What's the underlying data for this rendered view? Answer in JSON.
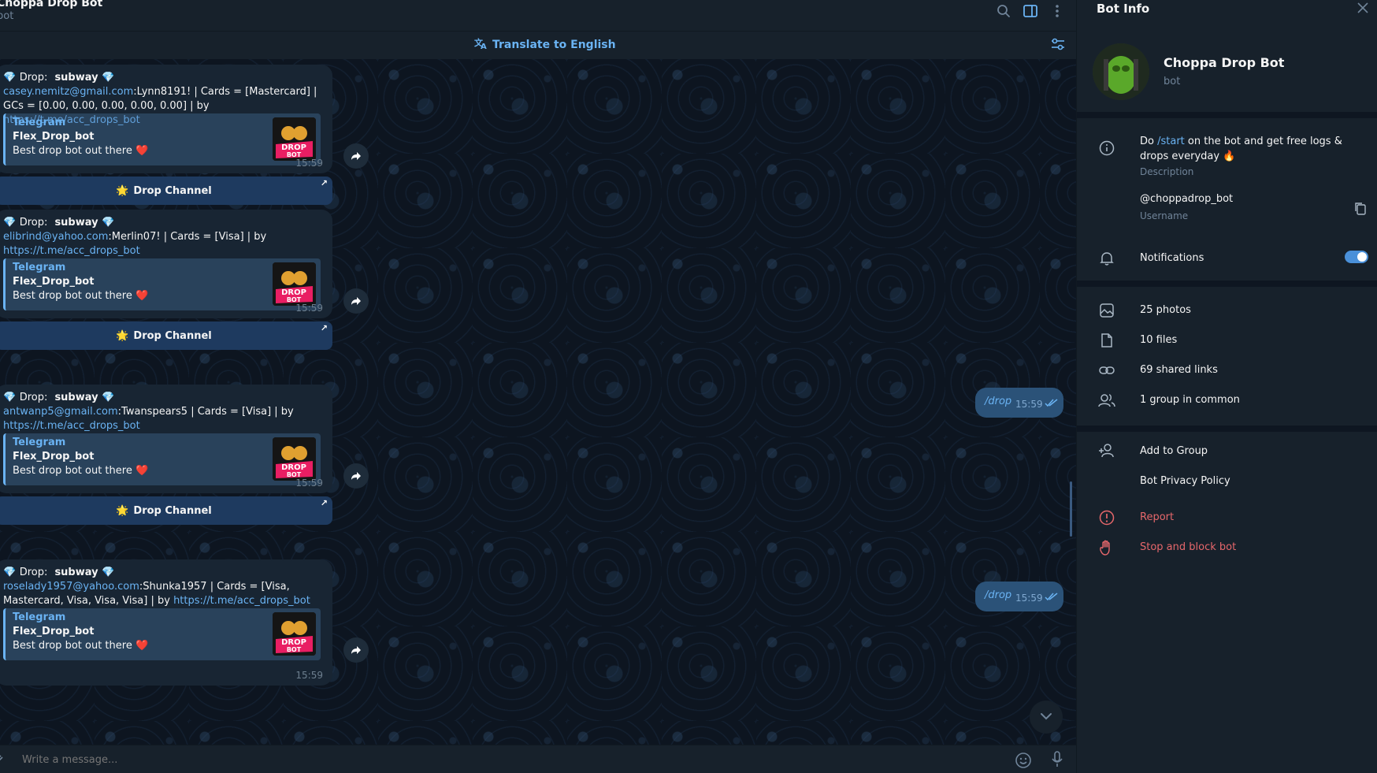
{
  "header": {
    "title": "Choppa Drop Bot",
    "status": "bot"
  },
  "translate": {
    "label": "Translate to English"
  },
  "messages": [
    {
      "drop_label": "Drop:",
      "drop_name": "subway",
      "email": "casey.nemitz@gmail.com",
      "body": ":Lynn8191! | Cards = [Mastercard] | GCs = [0.00, 0.00, 0.00, 0.00, 0.00] | by ",
      "link": "https://t.me/acc_drops_bot",
      "time": "15:59"
    },
    {
      "drop_label": "Drop:",
      "drop_name": "subway",
      "email": "elibrind@yahoo.com",
      "body": ":Merlin07! | Cards = [Visa] | by ",
      "link": "https://t.me/acc_drops_bot",
      "time": "15:59"
    },
    {
      "drop_label": "Drop:",
      "drop_name": "subway",
      "email": "antwanp5@gmail.com",
      "body": ":Twanspears5 | Cards = [Visa] | by ",
      "link": "https://t.me/acc_drops_bot",
      "time": "15:59"
    },
    {
      "drop_label": "Drop:",
      "drop_name": "subway",
      "email": "roselady1957@yahoo.com",
      "body": ":Shunka1957 | Cards = [Visa, Mastercard, Visa, Visa, Visa] | by ",
      "link": "https://t.me/acc_drops_bot",
      "time": "15:59"
    }
  ],
  "preview": {
    "site": "Telegram",
    "title": "Flex_Drop_bot",
    "description": "Best drop bot out there",
    "thumb_text_top": "DROP",
    "thumb_text_bottom": "BOT"
  },
  "channel_button": {
    "label": "Drop Channel"
  },
  "outgoing": [
    {
      "text": "/drop",
      "time": "15:59"
    },
    {
      "text": "/drop",
      "time": "15:59"
    }
  ],
  "composer": {
    "placeholder": "Write a message..."
  },
  "bot_info": {
    "panel_title": "Bot Info",
    "name": "Choppa Drop Bot",
    "subtitle": "bot",
    "description_pre": "Do ",
    "description_cmd": "/start",
    "description_post": " on the bot and get free logs & drops everyday",
    "description_label": "Description",
    "username": "@choppadrop_bot",
    "username_label": "Username",
    "notifications_label": "Notifications",
    "notifications_on": true,
    "media": [
      {
        "icon": "photo-icon",
        "label": "25 photos"
      },
      {
        "icon": "file-icon",
        "label": "10 files"
      },
      {
        "icon": "link-icon",
        "label": "69 shared links"
      },
      {
        "icon": "group-icon",
        "label": "1 group in common"
      }
    ],
    "add_to_group": "Add to Group",
    "privacy_policy": "Bot Privacy Policy",
    "report": "Report",
    "stop_block": "Stop and block bot"
  },
  "colors": {
    "accent": "#6ab3f3",
    "danger": "#e6676b",
    "panel_bg": "#17212b",
    "bubble_out": "#2b5278"
  }
}
